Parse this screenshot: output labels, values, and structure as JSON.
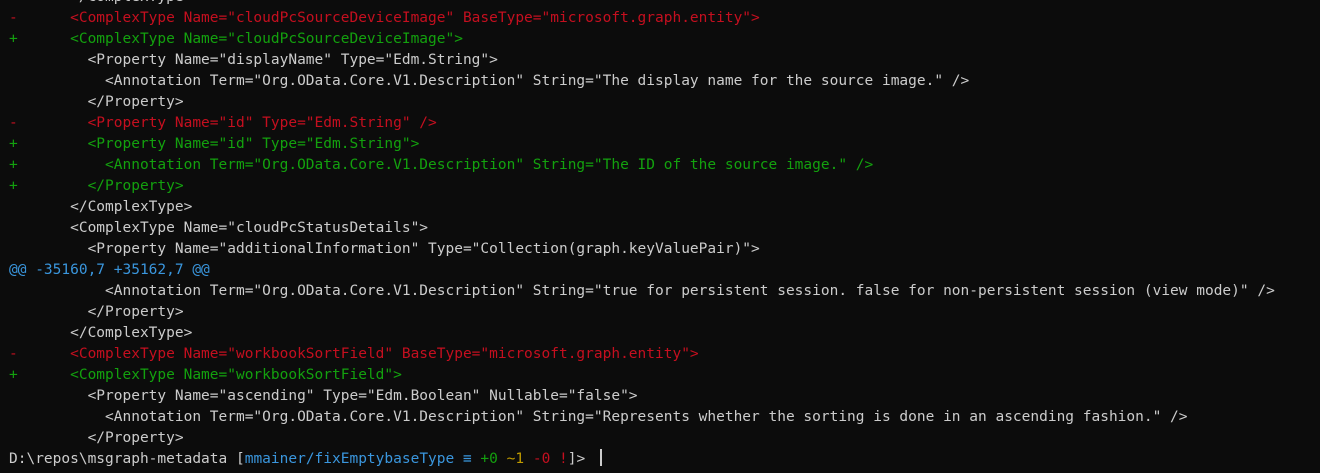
{
  "diff_lines": [
    {
      "kind": "ctx",
      "text": "       </ComplexType>"
    },
    {
      "kind": "del",
      "text": "-      <ComplexType Name=\"cloudPcSourceDeviceImage\" BaseType=\"microsoft.graph.entity\">"
    },
    {
      "kind": "add",
      "text": "+      <ComplexType Name=\"cloudPcSourceDeviceImage\">"
    },
    {
      "kind": "ctx",
      "text": "         <Property Name=\"displayName\" Type=\"Edm.String\">"
    },
    {
      "kind": "ctx",
      "text": "           <Annotation Term=\"Org.OData.Core.V1.Description\" String=\"The display name for the source image.\" />"
    },
    {
      "kind": "ctx",
      "text": "         </Property>"
    },
    {
      "kind": "del",
      "text": "-        <Property Name=\"id\" Type=\"Edm.String\" />"
    },
    {
      "kind": "add",
      "text": "+        <Property Name=\"id\" Type=\"Edm.String\">"
    },
    {
      "kind": "add",
      "text": "+          <Annotation Term=\"Org.OData.Core.V1.Description\" String=\"The ID of the source image.\" />"
    },
    {
      "kind": "add",
      "text": "+        </Property>"
    },
    {
      "kind": "ctx",
      "text": "       </ComplexType>"
    },
    {
      "kind": "ctx",
      "text": "       <ComplexType Name=\"cloudPcStatusDetails\">"
    },
    {
      "kind": "ctx",
      "text": "         <Property Name=\"additionalInformation\" Type=\"Collection(graph.keyValuePair)\">"
    },
    {
      "kind": "hunk",
      "text": "@@ -35160,7 +35162,7 @@"
    },
    {
      "kind": "ctx",
      "text": "           <Annotation Term=\"Org.OData.Core.V1.Description\" String=\"true for persistent session. false for non-persistent session (view mode)\" />"
    },
    {
      "kind": "ctx",
      "text": "         </Property>"
    },
    {
      "kind": "ctx",
      "text": "       </ComplexType>"
    },
    {
      "kind": "del",
      "text": "-      <ComplexType Name=\"workbookSortField\" BaseType=\"microsoft.graph.entity\">"
    },
    {
      "kind": "add",
      "text": "+      <ComplexType Name=\"workbookSortField\">"
    },
    {
      "kind": "ctx",
      "text": "         <Property Name=\"ascending\" Type=\"Edm.Boolean\" Nullable=\"false\">"
    },
    {
      "kind": "ctx",
      "text": "           <Annotation Term=\"Org.OData.Core.V1.Description\" String=\"Represents whether the sorting is done in an ascending fashion.\" />"
    },
    {
      "kind": "ctx",
      "text": "         </Property>"
    }
  ],
  "prompt": {
    "path": "D:\\repos\\msgraph-metadata ",
    "open_bracket": "[",
    "branch": "mmainer/fixEmptybaseType",
    "sync_symbol": " ≡",
    "stat_added": " +0",
    "stat_modified": " ~1",
    "stat_deleted": " -0",
    "stat_flag": " !",
    "close_bracket": "]> "
  }
}
